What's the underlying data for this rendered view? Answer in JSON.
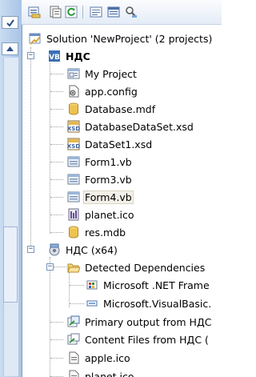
{
  "toolbar": {
    "buttons": [
      {
        "name": "properties-icon"
      },
      {
        "name": "open-file-icon"
      },
      {
        "name": "refresh-icon"
      },
      {
        "name": "view-code-icon"
      },
      {
        "name": "view-designer-icon"
      },
      {
        "name": "class-view-icon"
      }
    ]
  },
  "tree": {
    "solution_label": "Solution 'NewProject' (2 projects)",
    "project": {
      "name": "НДС",
      "items": [
        {
          "label": "My Project",
          "icon": "my-project-icon"
        },
        {
          "label": "app.config",
          "icon": "config-file-icon"
        },
        {
          "label": "Database.mdf",
          "icon": "database-icon"
        },
        {
          "label": "DatabaseDataSet.xsd",
          "icon": "dataset-icon"
        },
        {
          "label": "DataSet1.xsd",
          "icon": "dataset-icon"
        },
        {
          "label": "Form1.vb",
          "icon": "form-icon"
        },
        {
          "label": "Form3.vb",
          "icon": "form-icon"
        },
        {
          "label": "Form4.vb",
          "icon": "form-icon"
        },
        {
          "label": "planet.ico",
          "icon": "ico-file-icon"
        },
        {
          "label": "res.mdb",
          "icon": "database-icon"
        }
      ]
    },
    "setup_project": {
      "name": "НДС (x64)",
      "detected_label": "Detected Dependencies",
      "dependencies": [
        "Microsoft .NET Frame",
        "Microsoft.VisualBasic."
      ],
      "outputs": [
        "Primary output from НДС",
        "Content Files from НДС ("
      ],
      "files": [
        "apple.ico",
        "planet.ico"
      ]
    }
  },
  "colors": {
    "selection_bg": "#f2f0e8",
    "left_panel": "#b8cfe9",
    "toolbar_bg": "#e4ecf7"
  }
}
